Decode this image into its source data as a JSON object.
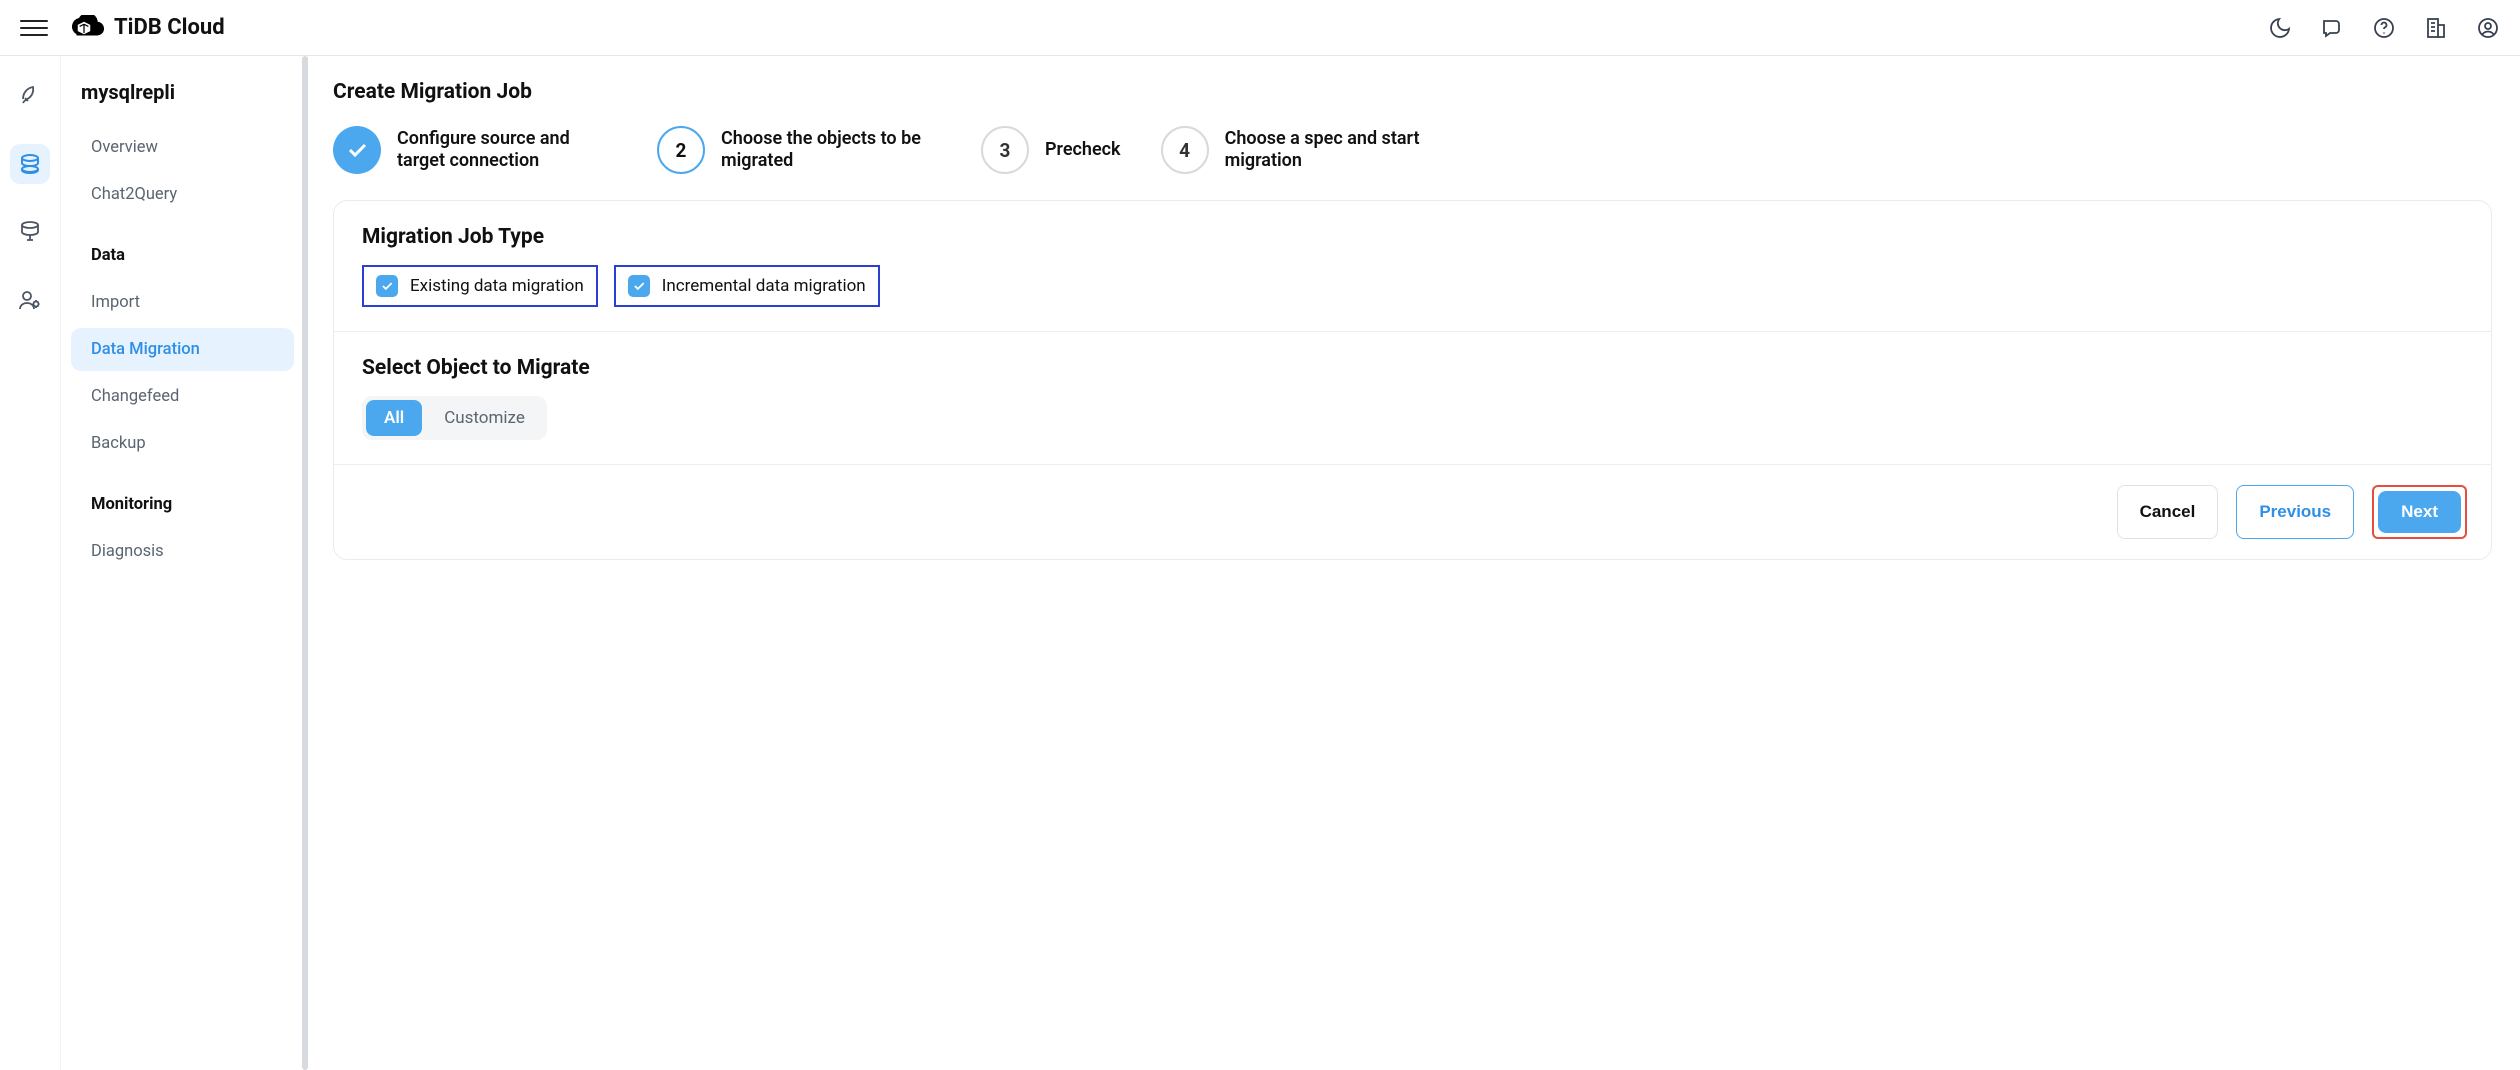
{
  "header": {
    "brand": "TiDB Cloud"
  },
  "sidebar": {
    "cluster_name": "mysqlrepli",
    "items": {
      "overview": "Overview",
      "chat2query": "Chat2Query",
      "data_section": "Data",
      "import": "Import",
      "data_migration": "Data Migration",
      "changefeed": "Changefeed",
      "backup": "Backup",
      "monitoring_section": "Monitoring",
      "diagnosis": "Diagnosis"
    }
  },
  "main": {
    "page_title": "Create Migration Job",
    "steps": {
      "s1": "Configure source and target connection",
      "s2_num": "2",
      "s2": "Choose the objects to be migrated",
      "s3_num": "3",
      "s3": "Precheck",
      "s4_num": "4",
      "s4": "Choose a spec and start migration"
    },
    "jobtype": {
      "heading": "Migration Job Type",
      "existing": "Existing data migration",
      "incremental": "Incremental data migration"
    },
    "select_object": {
      "heading": "Select Object to Migrate",
      "all": "All",
      "customize": "Customize"
    },
    "footer": {
      "cancel": "Cancel",
      "previous": "Previous",
      "next": "Next"
    }
  }
}
